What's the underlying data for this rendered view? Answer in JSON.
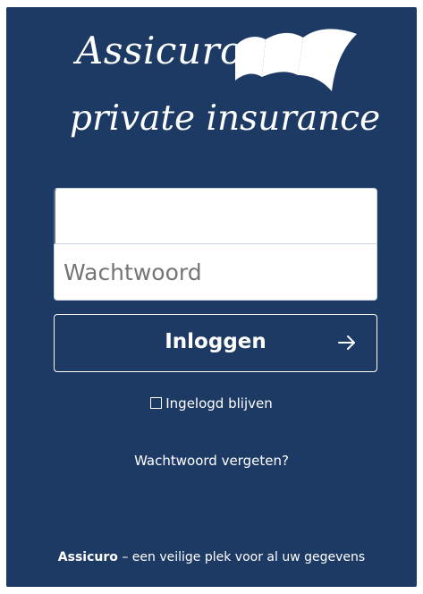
{
  "brand": {
    "name": "Assicuro",
    "tagline": "private insurance"
  },
  "login": {
    "username_value": "",
    "username_placeholder": "",
    "password_placeholder": "Wachtwoord",
    "submit_label": "Inloggen",
    "submit_icon": "arrow-right-icon",
    "remember_label": "Ingelogd blijven",
    "remember_checked": false,
    "forgot_label": "Wachtwoord vergeten?"
  },
  "footer": {
    "brand": "Assicuro",
    "text": "– een veilige plek voor al uw gegevens"
  },
  "colors": {
    "background": "#1d3a65",
    "text": "#ffffff"
  }
}
